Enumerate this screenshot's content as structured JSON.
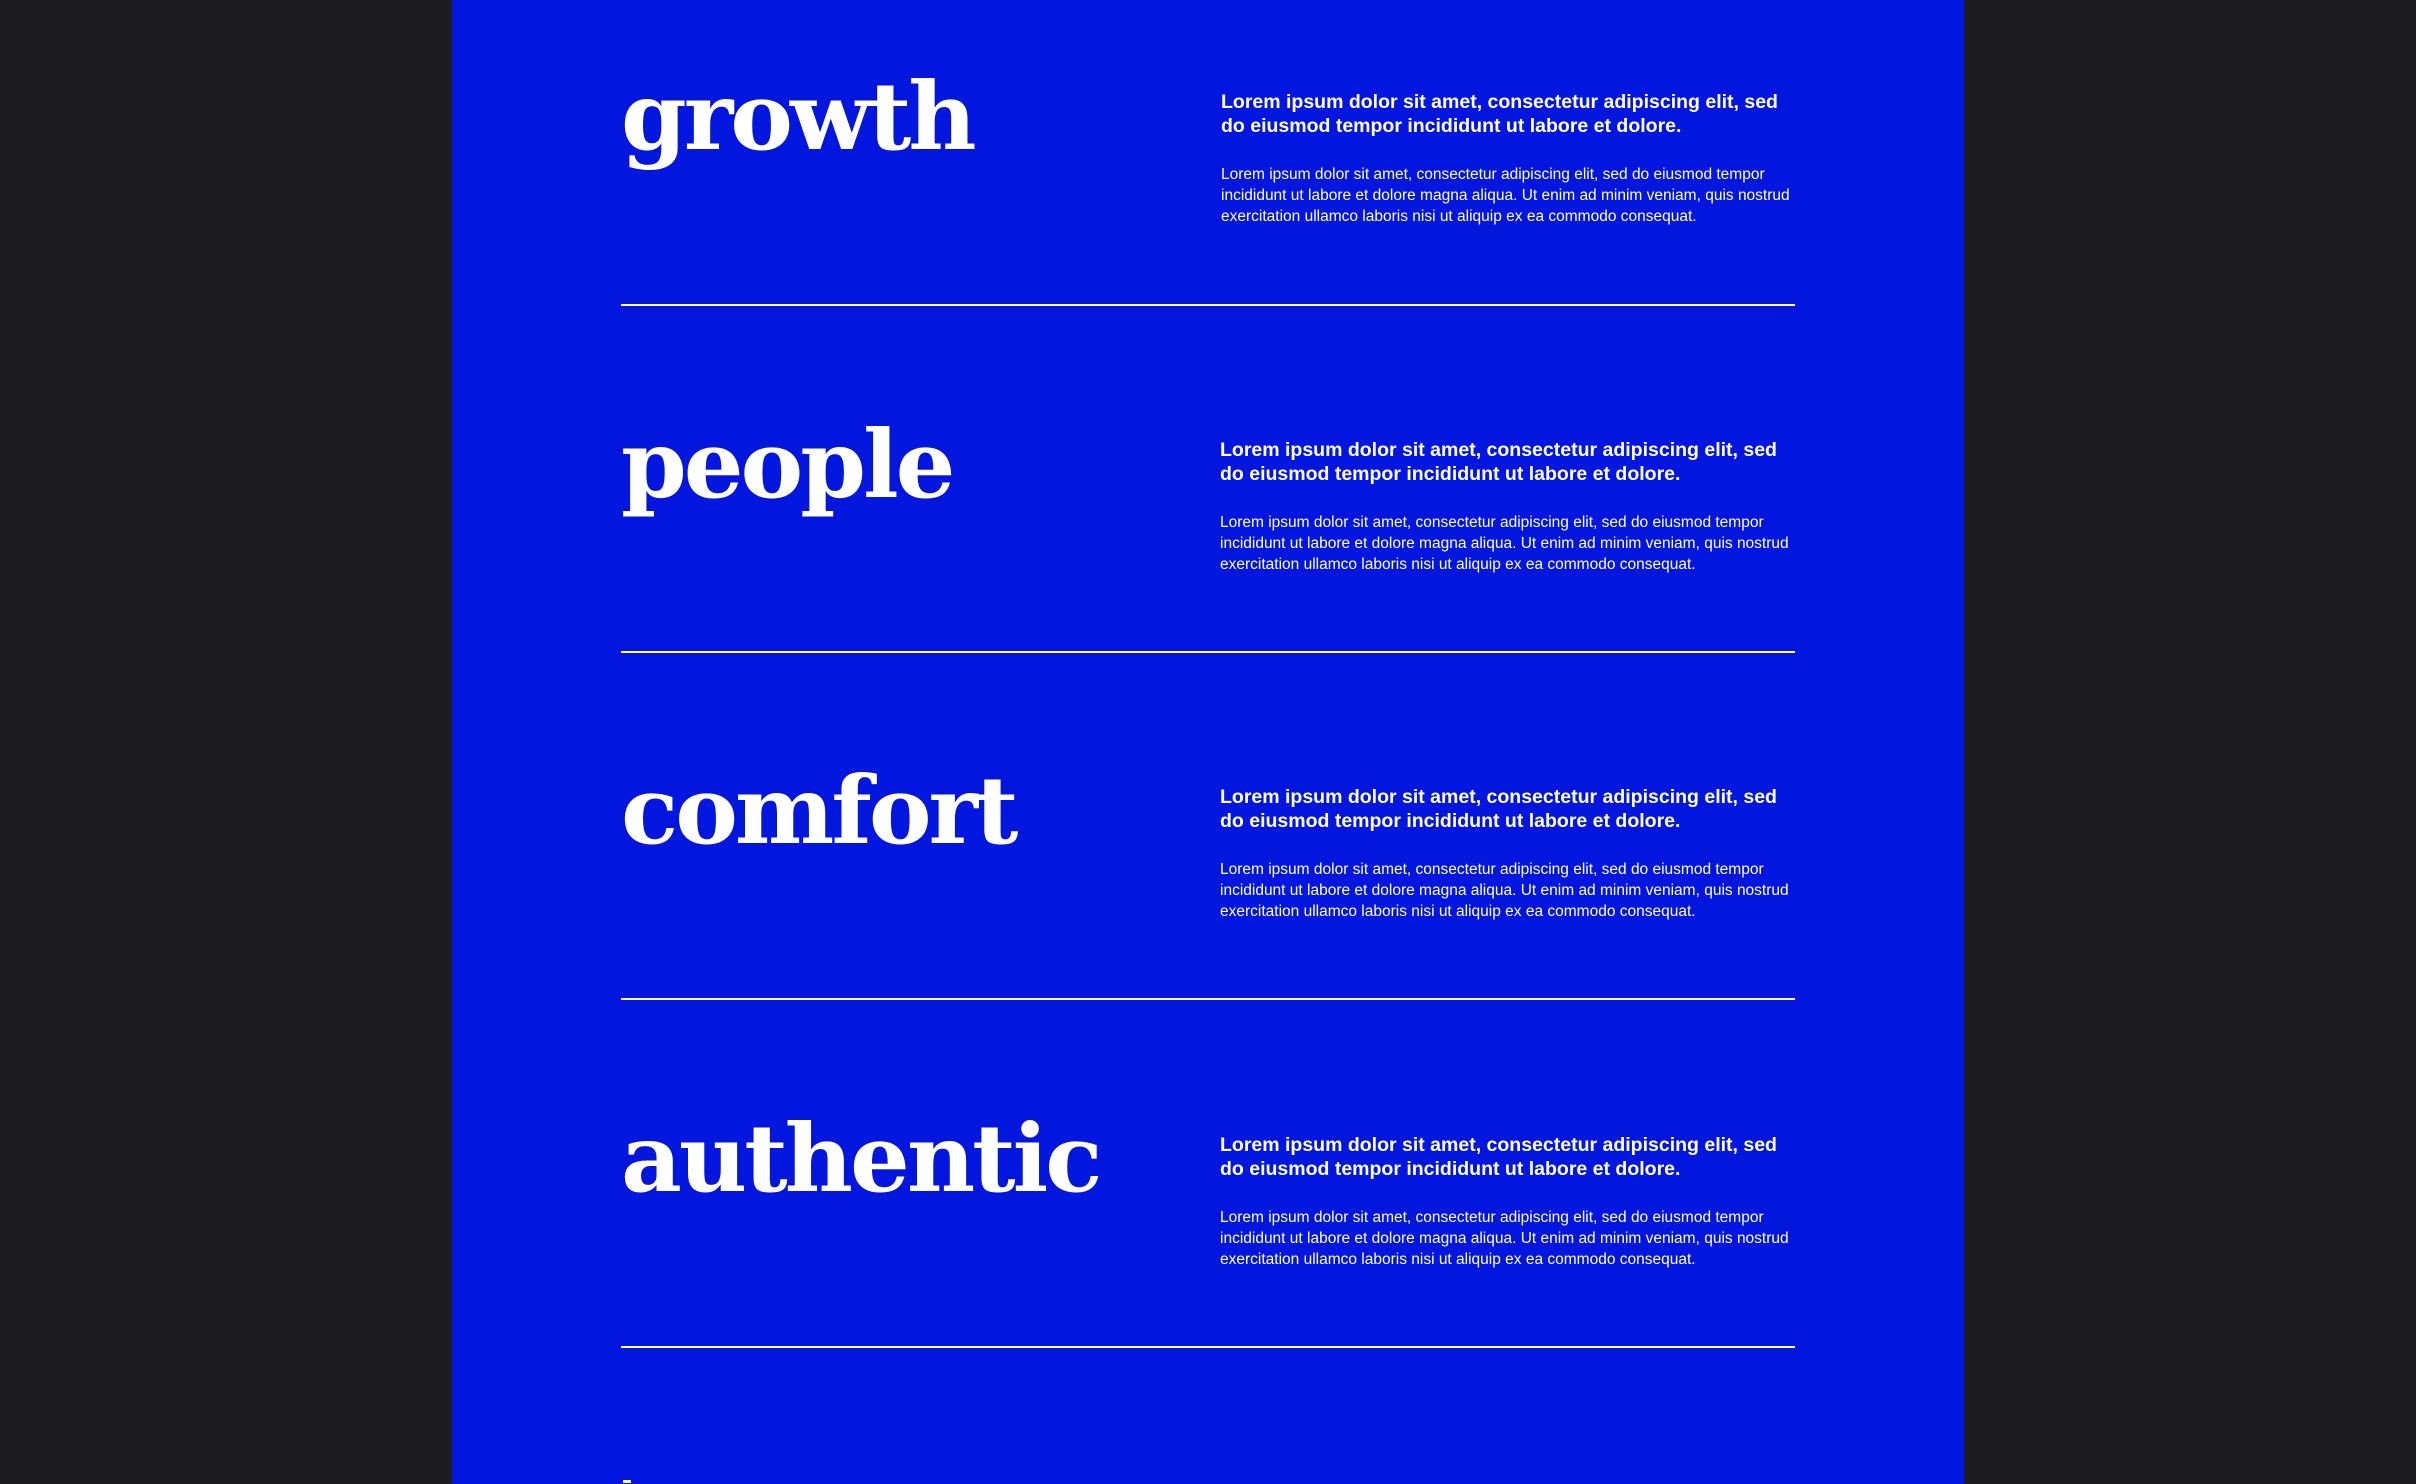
{
  "colors": {
    "background": "#1b1c21",
    "panel": "#0316de",
    "text": "#ffffff"
  },
  "sections": [
    {
      "word": "growth",
      "lead": "Lorem ipsum dolor sit amet, consectetur adipiscing elit, sed do eiusmod tempor incididunt ut labore et dolore.",
      "body": "Lorem ipsum dolor sit amet, consectetur adipiscing elit, sed do eiusmod tempor incididunt ut labore et dolore magna aliqua. Ut enim ad minim veniam, quis nostrud exercitation ullamco laboris nisi ut aliquip ex ea commodo consequat."
    },
    {
      "word": "people",
      "lead": "Lorem ipsum dolor sit amet, consectetur adipiscing elit, sed do eiusmod tempor incididunt ut labore et dolore.",
      "body": "Lorem ipsum dolor sit amet, consectetur adipiscing elit, sed do eiusmod tempor incididunt ut labore et dolore magna aliqua. Ut enim ad minim veniam, quis nostrud exercitation ullamco laboris nisi ut aliquip ex ea commodo consequat."
    },
    {
      "word": "comfort",
      "lead": "Lorem ipsum dolor sit amet, consectetur adipiscing elit, sed do eiusmod tempor incididunt ut labore et dolore.",
      "body": "Lorem ipsum dolor sit amet, consectetur adipiscing elit, sed do eiusmod tempor incididunt ut labore et dolore magna aliqua. Ut enim ad minim veniam, quis nostrud exercitation ullamco laboris nisi ut aliquip ex ea commodo consequat."
    },
    {
      "word": "authentic",
      "lead": "Lorem ipsum dolor sit amet, consectetur adipiscing elit, sed do eiusmod tempor incididunt ut labore et dolore.",
      "body": "Lorem ipsum dolor sit amet, consectetur adipiscing elit, sed do eiusmod tempor incididunt ut labore et dolore magna aliqua. Ut enim ad minim veniam, quis nostrud exercitation ullamco laboris nisi ut aliquip ex ea commodo consequat."
    }
  ]
}
